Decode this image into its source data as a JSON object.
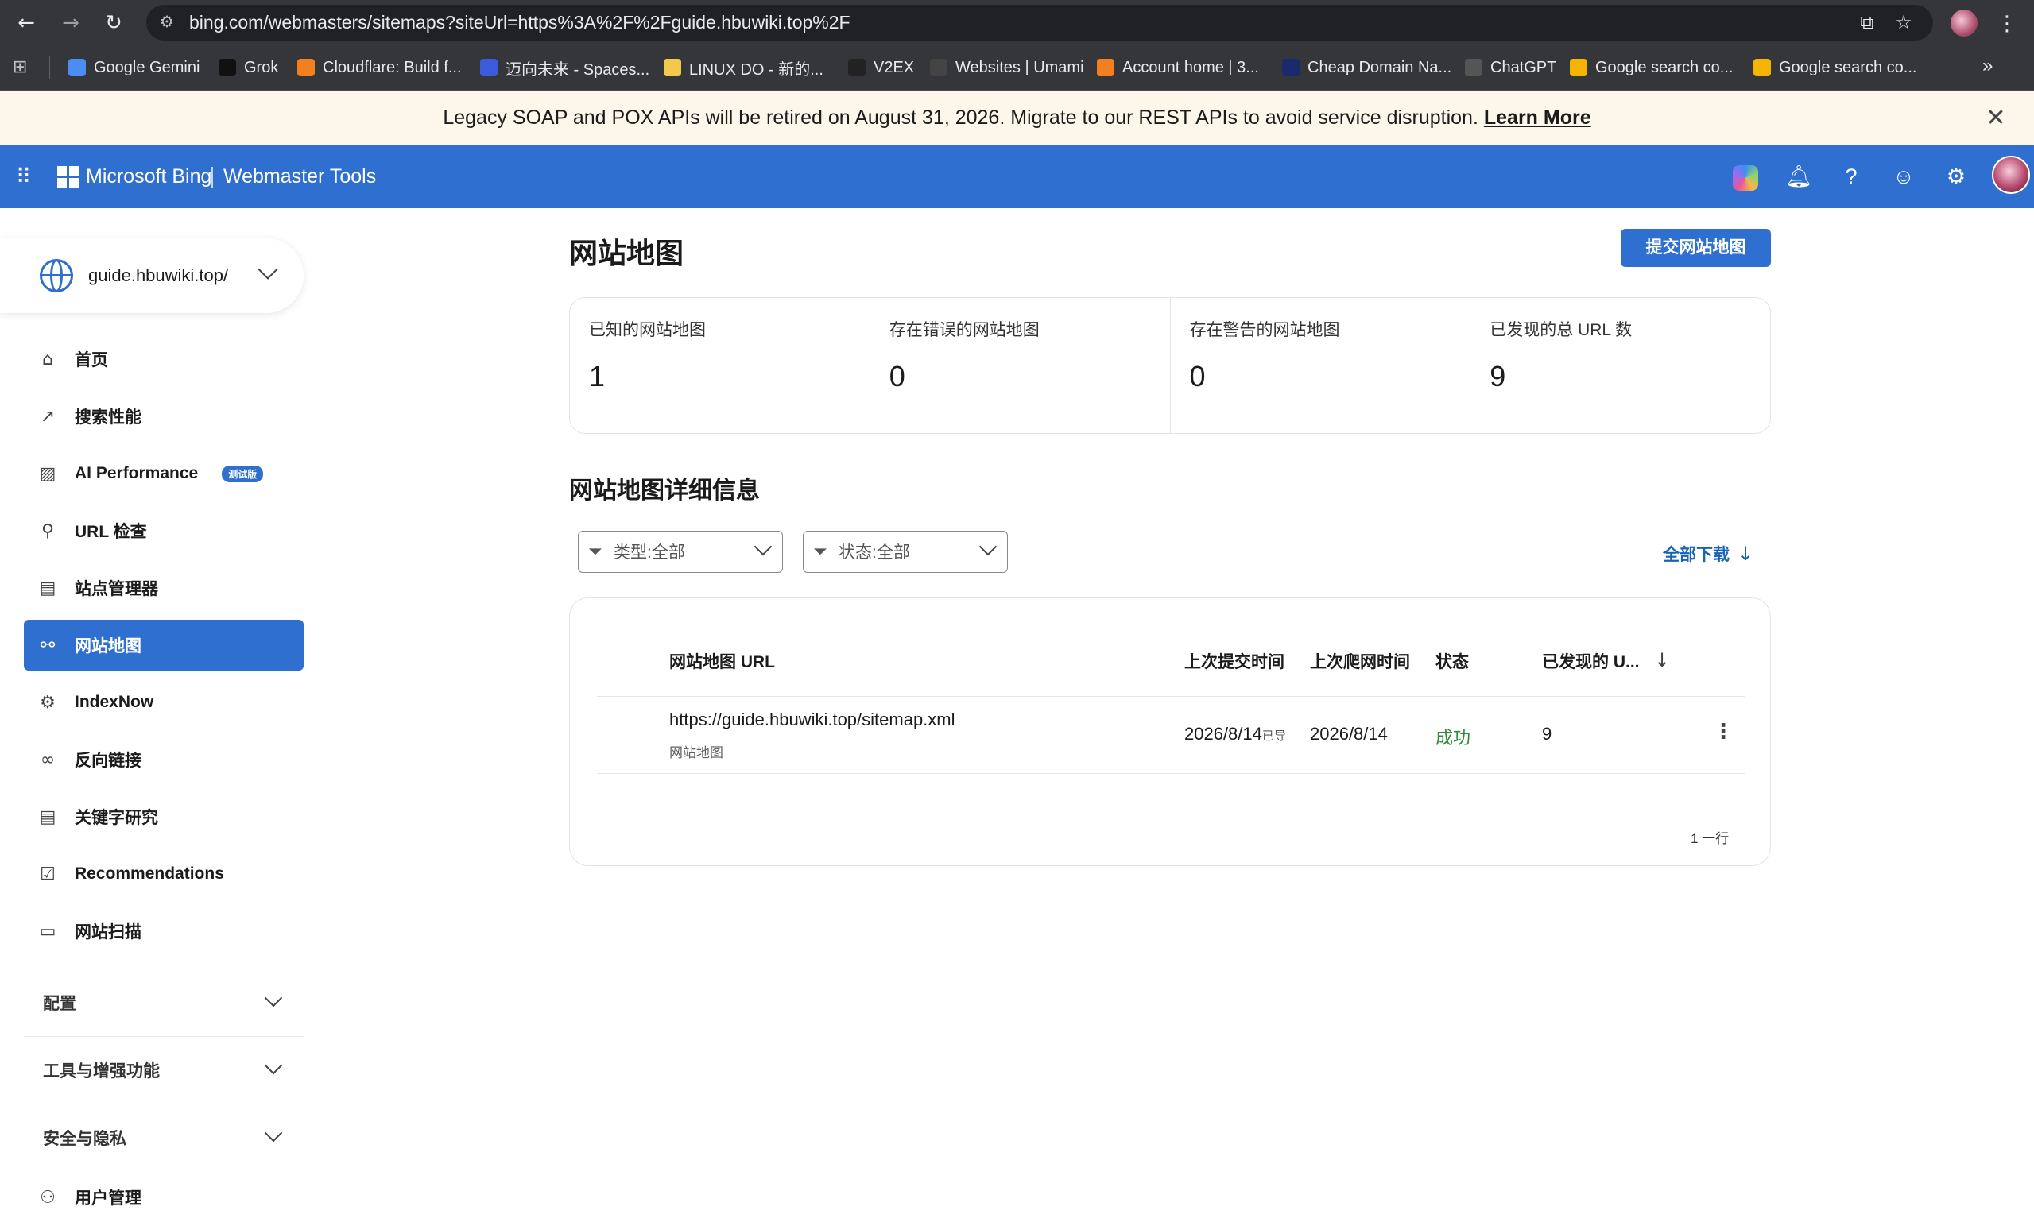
{
  "browser": {
    "url": "bing.com/webmasters/sitemaps?siteUrl=https%3A%2F%2Fguide.hbuwiki.top%2F",
    "bookmarks": [
      {
        "label": "Google Gemini",
        "color": "#4b8cf5"
      },
      {
        "label": "Grok",
        "color": "#111111"
      },
      {
        "label": "Cloudflare: Build f...",
        "color": "#f38020"
      },
      {
        "label": "迈向未来 - Spaces...",
        "color": "#3b5bdb"
      },
      {
        "label": "LINUX DO - 新的...",
        "color": "#f2c94c"
      },
      {
        "label": "V2EX",
        "color": "#222222"
      },
      {
        "label": "Websites | Umami",
        "color": "#444444"
      },
      {
        "label": "Account home | 3...",
        "color": "#f38020"
      },
      {
        "label": "Cheap Domain Na...",
        "color": "#1a2a6c"
      },
      {
        "label": "ChatGPT",
        "color": "#555555"
      },
      {
        "label": "Google search co...",
        "color": "#f4b400"
      },
      {
        "label": "Google search co...",
        "color": "#f4b400"
      }
    ]
  },
  "banner": {
    "text": "Legacy SOAP and POX APIs will be retired on August 31, 2026. Migrate to our REST APIs to avoid service disruption.",
    "link": "Learn More"
  },
  "header": {
    "brand": "Microsoft Bing",
    "product": "Webmaster Tools",
    "accent": "#2f6fd0"
  },
  "sidebar": {
    "site": "guide.hbuwiki.top/",
    "items": [
      {
        "label": "首页",
        "icon": "home-icon"
      },
      {
        "label": "搜索性能",
        "icon": "trend-icon"
      },
      {
        "label": "AI Performance",
        "icon": "ai-chart-icon",
        "badge": "测试版"
      },
      {
        "label": "URL 检查",
        "icon": "search-icon"
      },
      {
        "label": "站点管理器",
        "icon": "document-icon"
      },
      {
        "label": "网站地图",
        "icon": "sitemap-icon",
        "active": true
      },
      {
        "label": "IndexNow",
        "icon": "gear-icon"
      },
      {
        "label": "反向链接",
        "icon": "link-icon"
      },
      {
        "label": "关键字研究",
        "icon": "document-icon"
      },
      {
        "label": "Recommendations",
        "icon": "checklist-icon"
      },
      {
        "label": "网站扫描",
        "icon": "scan-icon"
      }
    ],
    "groups": [
      "配置",
      "工具与增强功能",
      "安全与隐私"
    ],
    "user_mgmt": "用户管理"
  },
  "main": {
    "title": "网站地图",
    "submit_button": "提交网站地图",
    "stats": [
      {
        "label": "已知的网站地图",
        "value": "1"
      },
      {
        "label": "存在错误的网站地图",
        "value": "0"
      },
      {
        "label": "存在警告的网站地图",
        "value": "0"
      },
      {
        "label": "已发现的总 URL 数",
        "value": "9"
      }
    ],
    "details_title": "网站地图详细信息",
    "filters": {
      "type": "类型:全部",
      "status": "状态:全部"
    },
    "download_all": "全部下载",
    "table": {
      "headers": {
        "url": "网站地图 URL",
        "submitted": "上次提交时间",
        "crawled": "上次爬网时间",
        "status": "状态",
        "discovered": "已发现的 U..."
      },
      "rows": [
        {
          "url": "https://guide.hbuwiki.top/sitemap.xml",
          "type": "网站地图",
          "submitted": "2026/8/14",
          "submitted_suffix": "已导",
          "crawled": "2026/8/14",
          "status": "成功",
          "discovered": "9"
        }
      ],
      "row_count": "1 一行"
    }
  }
}
